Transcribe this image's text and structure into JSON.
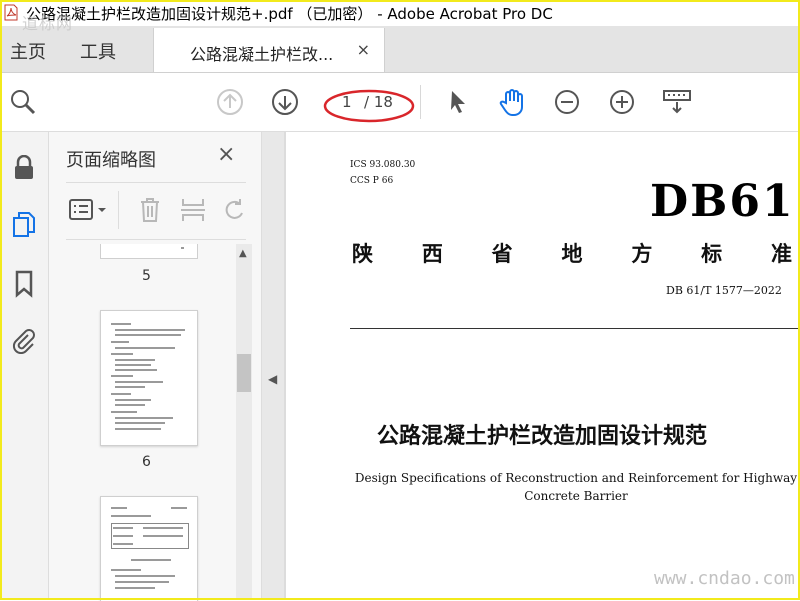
{
  "window": {
    "title": "公路混凝土护栏改造加固设计规范+.pdf （已加密） - Adobe Acrobat Pro DC"
  },
  "watermark": {
    "top": "道标网",
    "bottom": "www.cndao.com"
  },
  "tabs": {
    "home": "主页",
    "tools": "工具",
    "document": "公路混凝土护栏改...",
    "close": "×"
  },
  "toolbar": {
    "current_page": "1",
    "total_pages": "/ 18"
  },
  "thumbnails": {
    "title": "页面缩略图",
    "close": "×",
    "pages": [
      {
        "label": "5"
      },
      {
        "label": "6"
      }
    ]
  },
  "document": {
    "ics": "ICS 93.080.30",
    "ccs": "CCS P 66",
    "db": "DB61",
    "standard_type": [
      "陕",
      "西",
      "省",
      "地",
      "方",
      "标",
      "准"
    ],
    "code": "DB 61/T 1577—2022",
    "title_cn": "公路混凝土护栏改造加固设计规范",
    "title_en": "Design Specifications of Reconstruction and Reinforcement for Highway Concrete Barrier"
  },
  "colors": {
    "accent": "#1473e6",
    "highlight_ellipse": "#d9262b",
    "frame": "#f2ea1c"
  }
}
